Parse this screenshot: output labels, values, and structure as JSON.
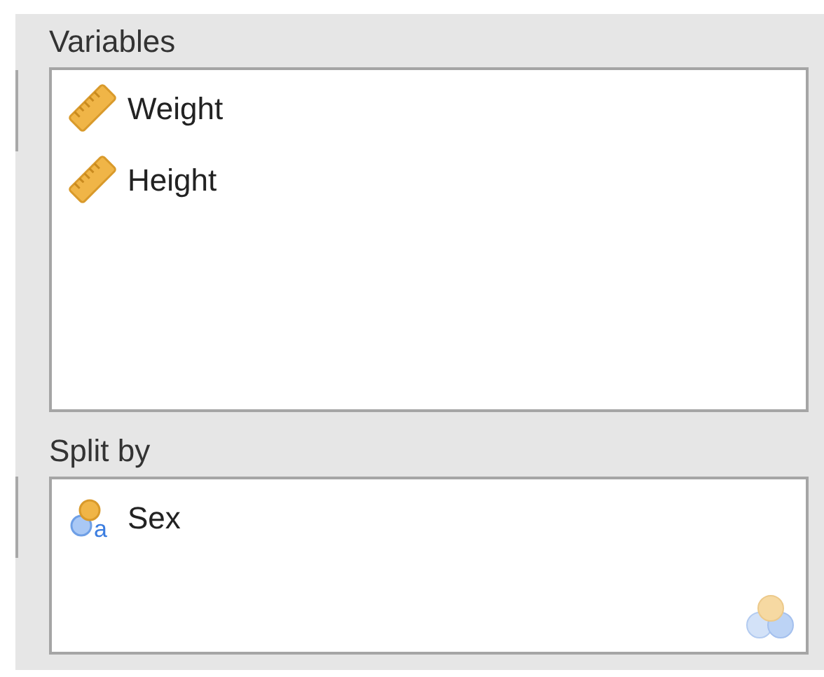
{
  "panels": [
    {
      "label": "Variables",
      "variables": [
        {
          "kind": "continuous",
          "name": "Weight"
        },
        {
          "kind": "continuous",
          "name": "Height"
        }
      ]
    },
    {
      "label": "Split by",
      "variables": [
        {
          "kind": "nominal",
          "name": "Sex",
          "icon_letter": "a"
        }
      ],
      "drop_hint_icon": true
    }
  ]
}
